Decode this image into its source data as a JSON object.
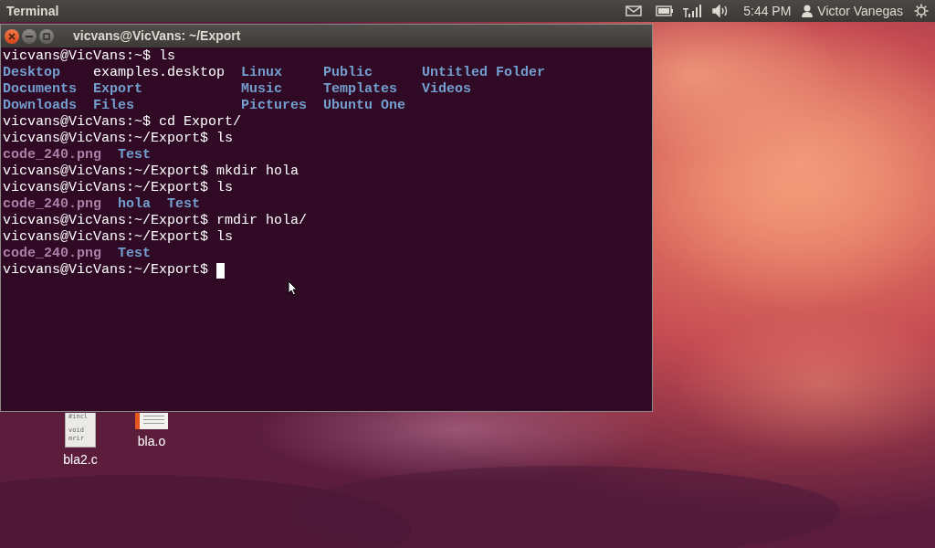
{
  "top_panel": {
    "app_title": "Terminal",
    "clock": "5:44 PM",
    "user": "Victor Vanegas"
  },
  "terminal": {
    "title": "vicvans@VicVans: ~/Export",
    "lines": [
      {
        "kind": "prompt",
        "text": "vicvans@VicVans:~$ ls"
      },
      {
        "kind": "listing",
        "rows": [
          [
            {
              "text": "Desktop",
              "kind": "dir"
            },
            {
              "text": "examples.desktop",
              "kind": "plain"
            },
            {
              "text": "Linux",
              "kind": "dir"
            },
            {
              "text": "Public",
              "kind": "dir"
            },
            {
              "text": "Untitled Folder",
              "kind": "dir"
            }
          ],
          [
            {
              "text": "Documents",
              "kind": "dir"
            },
            {
              "text": "Export",
              "kind": "dir"
            },
            {
              "text": "Music",
              "kind": "dir"
            },
            {
              "text": "Templates",
              "kind": "dir"
            },
            {
              "text": "Videos",
              "kind": "dir"
            }
          ],
          [
            {
              "text": "Downloads",
              "kind": "dir"
            },
            {
              "text": "Files",
              "kind": "dir"
            },
            {
              "text": "Pictures",
              "kind": "dir"
            },
            {
              "text": "Ubuntu One",
              "kind": "dir"
            }
          ]
        ]
      },
      {
        "kind": "prompt",
        "text": "vicvans@VicVans:~$ cd Export/"
      },
      {
        "kind": "prompt",
        "text": "vicvans@VicVans:~/Export$ ls"
      },
      {
        "kind": "listing",
        "rows": [
          [
            {
              "text": "code_240.png"
            },
            {
              "text": "Test",
              "kind": "dir"
            }
          ]
        ]
      },
      {
        "kind": "prompt",
        "text": "vicvans@VicVans:~/Export$ mkdir hola"
      },
      {
        "kind": "prompt",
        "text": "vicvans@VicVans:~/Export$ ls"
      },
      {
        "kind": "listing",
        "rows": [
          [
            {
              "text": "code_240.png"
            },
            {
              "text": "hola",
              "kind": "dir"
            },
            {
              "text": "Test",
              "kind": "dir"
            }
          ]
        ]
      },
      {
        "kind": "prompt",
        "text": "vicvans@VicVans:~/Export$ rmdir hola/"
      },
      {
        "kind": "prompt",
        "text": "vicvans@VicVans:~/Export$ ls"
      },
      {
        "kind": "listing",
        "rows": [
          [
            {
              "text": "code_240.png"
            },
            {
              "text": "Test",
              "kind": "dir"
            }
          ]
        ]
      },
      {
        "kind": "prompt",
        "text": "vicvans@VicVans:~/Export$ ",
        "cursor": true
      }
    ]
  },
  "desktop_icons": [
    {
      "label": "bla2.c",
      "kind": "source",
      "preview": [
        "#incl",
        "void",
        "mrir"
      ]
    },
    {
      "label": "bla.o",
      "kind": "object"
    }
  ]
}
